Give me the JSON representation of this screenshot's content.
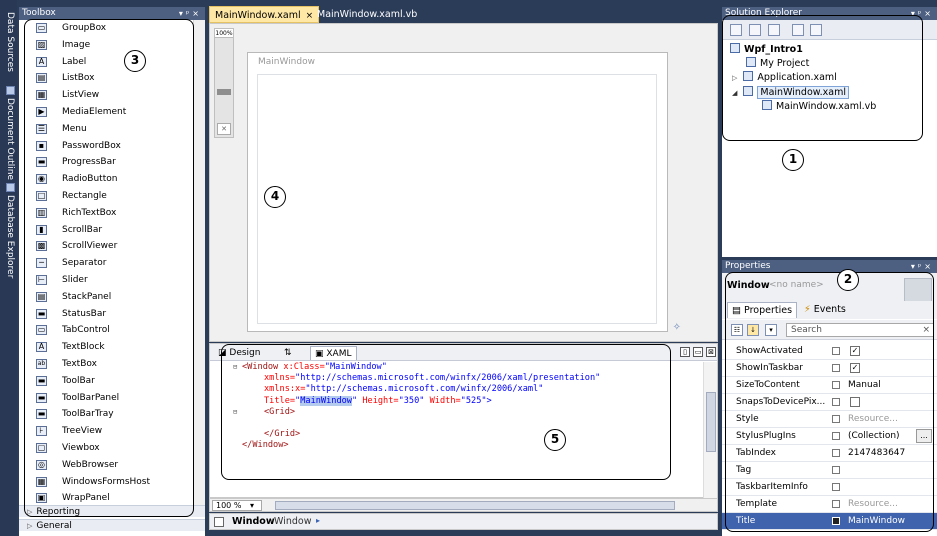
{
  "side_tabs": [
    "Data Sources",
    "Document Outline",
    "Database Explorer"
  ],
  "toolbox": {
    "title": "Toolbox",
    "items": [
      "GroupBox",
      "Image",
      "Label",
      "ListBox",
      "ListView",
      "MediaElement",
      "Menu",
      "PasswordBox",
      "ProgressBar",
      "RadioButton",
      "Rectangle",
      "RichTextBox",
      "ScrollBar",
      "ScrollViewer",
      "Separator",
      "Slider",
      "StackPanel",
      "StatusBar",
      "TabControl",
      "TextBlock",
      "TextBox",
      "ToolBar",
      "ToolBarPanel",
      "ToolBarTray",
      "TreeView",
      "Viewbox",
      "WebBrowser",
      "WindowsFormsHost",
      "WrapPanel"
    ],
    "groups": [
      "Reporting",
      "General"
    ]
  },
  "doc_tabs": [
    {
      "label": "MainWindow.xaml",
      "active": true
    },
    {
      "label": "MainWindow.xaml.vb",
      "active": false
    }
  ],
  "designer": {
    "zoom_label": "100%",
    "window_title": "MainWindow"
  },
  "xaml": {
    "tabs": [
      "Design",
      "⇅",
      "XAML"
    ],
    "code": {
      "l1_tag": "<Window",
      "l1_attr": " x:Class=",
      "l1_val": "\"MainWindow\"",
      "l2_attr": "xmlns=",
      "l2_val": "\"http://schemas.microsoft.com/winfx/2006/xaml/presentation\"",
      "l3_attr": "xmlns:x=",
      "l3_val": "\"http://schemas.microsoft.com/winfx/2006/xaml\"",
      "l4_attr_title": "Title=",
      "l4_q1": "\"",
      "l4_sel": "MainWindow",
      "l4_q2": "\"",
      "l4_attr_h": " Height=",
      "l4_val_h": "\"350\"",
      "l4_attr_w": " Width=",
      "l4_val_w": "\"525\"",
      "l4_close": ">",
      "l5": "<Grid>",
      "l7": "</Grid>",
      "l8": "</Window>"
    },
    "zoom_value": "100 %"
  },
  "breadcrumb": {
    "element": "Window",
    "type": "Window"
  },
  "solution_explorer": {
    "title": "Solution Explorer",
    "tree": [
      {
        "label": "Wpf_Intro1",
        "bold": true
      },
      {
        "label": "My Project"
      },
      {
        "label": "Application.xaml"
      },
      {
        "label": "MainWindow.xaml",
        "selected": true
      },
      {
        "label": "MainWindow.xaml.vb"
      }
    ]
  },
  "properties": {
    "title": "Properties",
    "object_type": "Window",
    "object_name": "<no name>",
    "tabs": [
      "Properties",
      "Events"
    ],
    "search_placeholder": "Search",
    "rows": [
      {
        "name": "ShowActivated",
        "kind": "check",
        "checked": true
      },
      {
        "name": "ShowInTaskbar",
        "kind": "check",
        "checked": true
      },
      {
        "name": "SizeToContent",
        "kind": "text",
        "value": "Manual"
      },
      {
        "name": "SnapsToDevicePix...",
        "kind": "check",
        "checked": false
      },
      {
        "name": "Style",
        "kind": "grey",
        "value": "Resource..."
      },
      {
        "name": "StylusPlugIns",
        "kind": "ellipsis",
        "value": "(Collection)"
      },
      {
        "name": "TabIndex",
        "kind": "text",
        "value": "2147483647"
      },
      {
        "name": "Tag",
        "kind": "text",
        "value": ""
      },
      {
        "name": "TaskbarItemInfo",
        "kind": "text",
        "value": ""
      },
      {
        "name": "Template",
        "kind": "grey",
        "value": "Resource..."
      },
      {
        "name": "Title",
        "kind": "text",
        "value": "MainWindow",
        "selected": true
      }
    ]
  },
  "annotations": [
    "1",
    "2",
    "3",
    "4",
    "5"
  ],
  "colors": {
    "chrome": "#2b3c59",
    "panel_header": "#4d6082",
    "active_tab": "#ffe8a6",
    "selection": "#3f63ad"
  }
}
